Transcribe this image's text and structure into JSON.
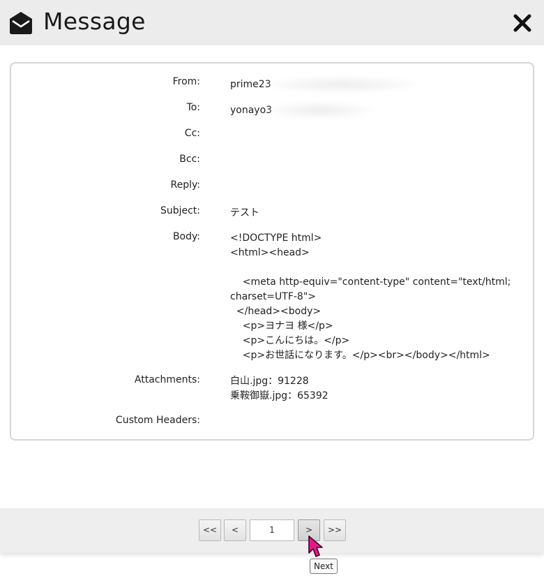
{
  "window": {
    "title": "Message"
  },
  "fields": {
    "from": {
      "label": "From:",
      "value": "prime23"
    },
    "to": {
      "label": "To:",
      "value": "yonayo3"
    },
    "cc": {
      "label": "Cc:",
      "value": ""
    },
    "bcc": {
      "label": "Bcc:",
      "value": ""
    },
    "reply": {
      "label": "Reply:",
      "value": ""
    },
    "subject": {
      "label": "Subject:",
      "value": "テスト"
    },
    "body": {
      "label": "Body:",
      "lines": [
        "<!DOCTYPE html>",
        "<html><head>",
        "",
        "    <meta http-equiv=\"content-type\" content=\"text/html;",
        "charset=UTF-8\">",
        "  </head><body>",
        "    <p>ヨナヨ 様</p>",
        "    <p>こんにちは。</p>",
        "    <p>お世話になります。</p><br></body></html>"
      ]
    },
    "attachments": {
      "label": "Attachments:",
      "items": [
        "白山.jpg：91228",
        "乗鞍御嶽.jpg：65392"
      ]
    },
    "custom_headers": {
      "label": "Custom Headers:",
      "value": ""
    }
  },
  "pagination": {
    "first_label": "<<",
    "prev_label": "<",
    "page_value": "1",
    "next_label": ">",
    "last_label": ">>",
    "tooltip": "Next"
  }
}
